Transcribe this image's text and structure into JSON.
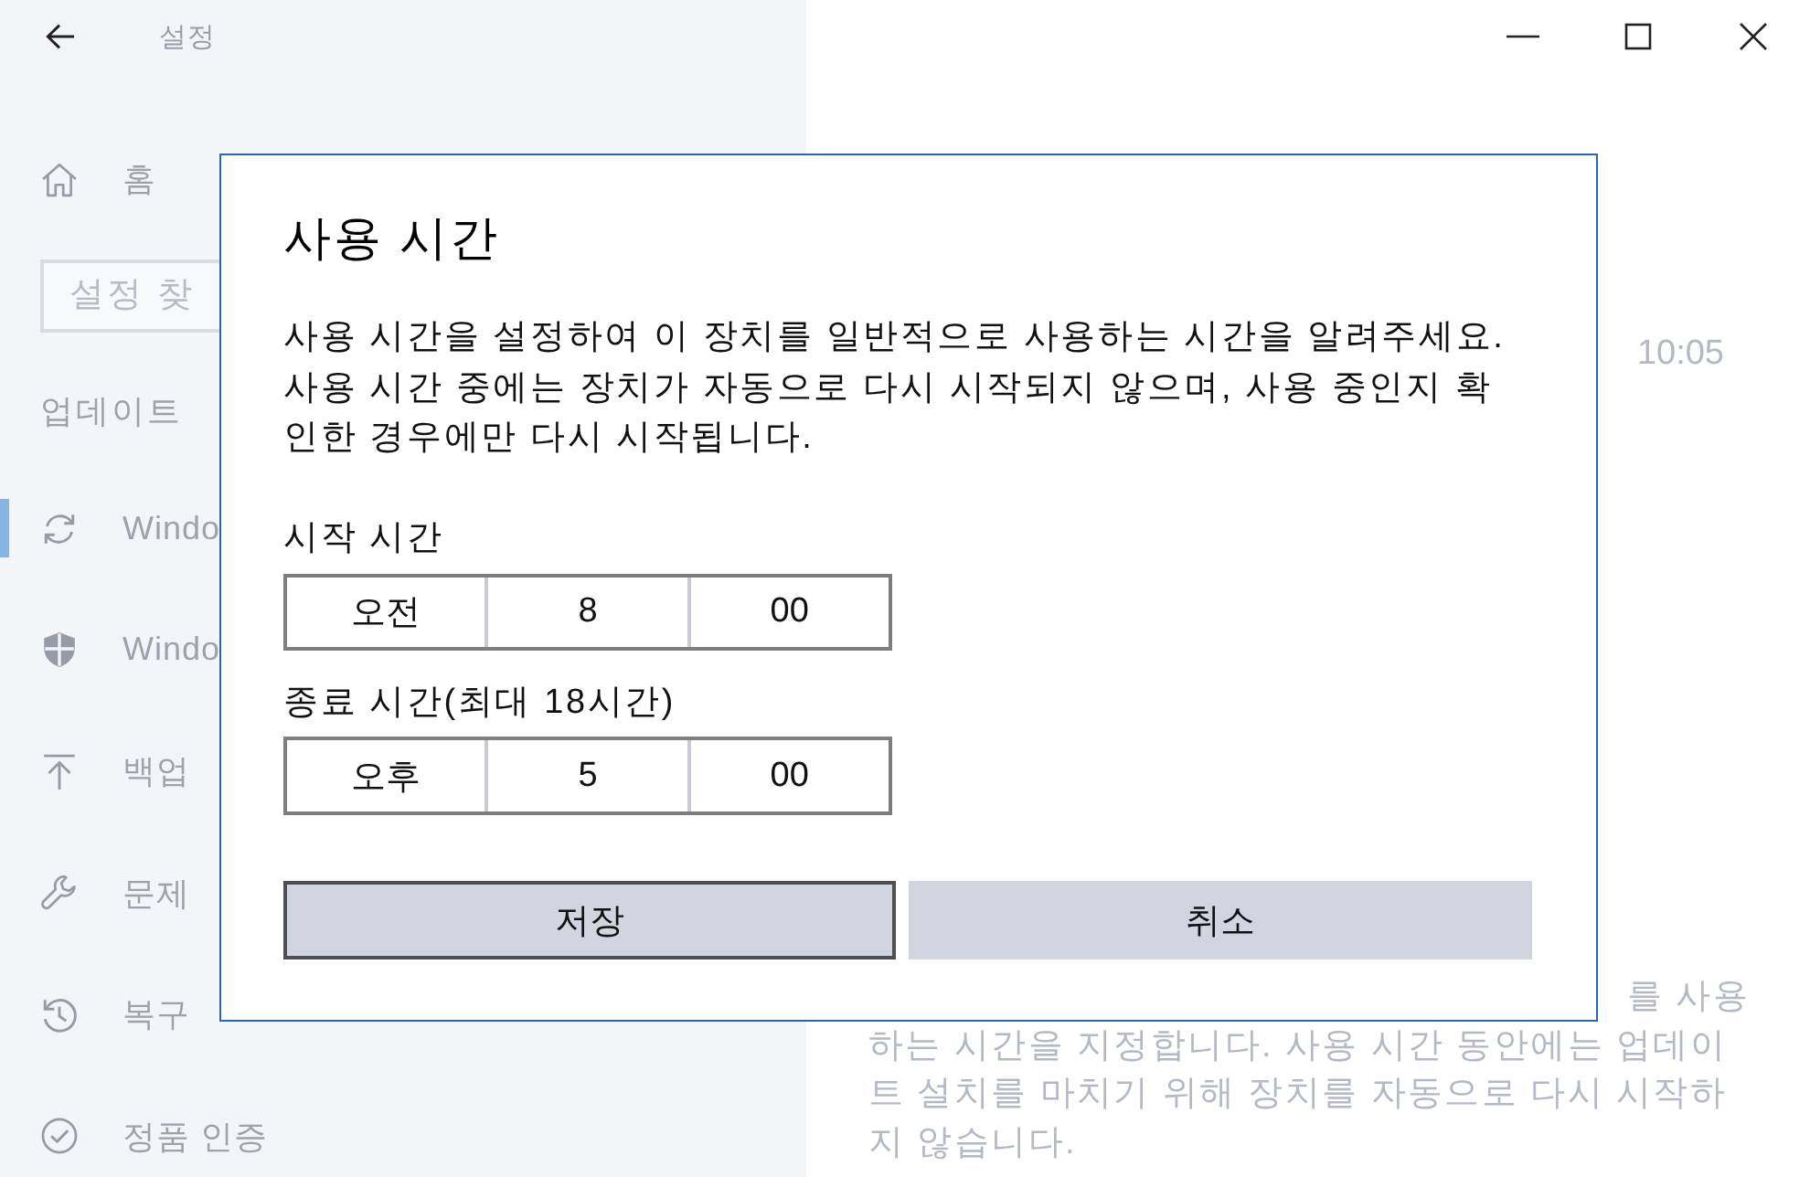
{
  "window": {
    "title": "설정"
  },
  "sidebar": {
    "home": {
      "label": "홈"
    },
    "search": {
      "placeholder": "설정 찾"
    },
    "section_title": "업데이트",
    "items": [
      {
        "label": "Windo",
        "selected": true
      },
      {
        "label": "Windo",
        "selected": false
      },
      {
        "label": "백업",
        "selected": false
      },
      {
        "label": "문제",
        "selected": false
      },
      {
        "label": "복구",
        "selected": false
      },
      {
        "label": "정품 인증",
        "selected": false
      }
    ]
  },
  "main": {
    "time": "10:05",
    "note_lines": [
      "를 사용",
      "하는 시간을 지정합니다. 사용 시간 동안에는 업데이",
      "트 설치를 마치기 위해 장치를 자동으로 다시 시작하",
      "지 않습니다."
    ]
  },
  "dialog": {
    "title": "사용 시간",
    "description": "사용 시간을 설정하여 이 장치를 일반적으로 사용하는 시간을 알려주세요. 사용 시간 중에는 장치가 자동으로 다시 시작되지 않으며, 사용 중인지 확인한 경우에만 다시 시작됩니다.",
    "fields": [
      {
        "label": "시작 시간",
        "parts": [
          "오전",
          "8",
          "00"
        ]
      },
      {
        "label": "종료 시간(최대 18시간)",
        "parts": [
          "오후",
          "5",
          "00"
        ]
      }
    ],
    "buttons": [
      {
        "label": "저장",
        "focused": true
      },
      {
        "label": "취소",
        "focused": false
      }
    ]
  }
}
